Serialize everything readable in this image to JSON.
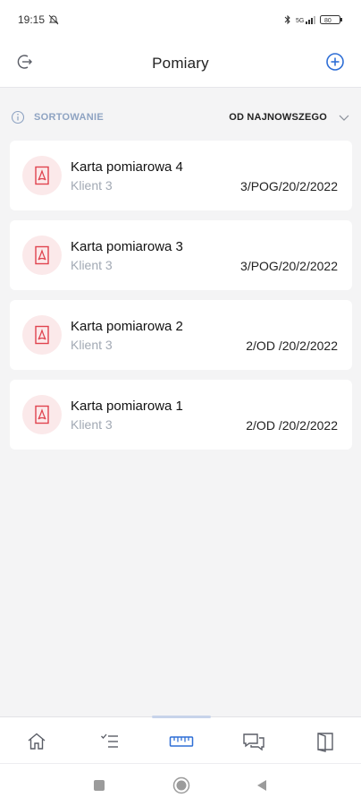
{
  "status_bar": {
    "time": "19:15",
    "icons": [
      "bell-off-icon",
      "bluetooth-icon",
      "signal-icon",
      "battery-icon"
    ],
    "battery": "80"
  },
  "header": {
    "title": "Pomiary",
    "left_icon": "logout-icon",
    "right_icon": "add-circle-icon"
  },
  "sort": {
    "label": "SORTOWANIE",
    "value": "OD NAJNOWSZEGO"
  },
  "cards": [
    {
      "name": "Karta pomiarowa 4",
      "client": "Klient 3",
      "code": "3/POG/20/2/2022",
      "icon": "pdf-icon"
    },
    {
      "name": "Karta pomiarowa 3",
      "client": "Klient 3",
      "code": "3/POG/20/2/2022",
      "icon": "pdf-icon"
    },
    {
      "name": "Karta pomiarowa 2",
      "client": "Klient 3",
      "code": "2/OD /20/2/2022",
      "icon": "pdf-icon"
    },
    {
      "name": "Karta pomiarowa 1",
      "client": "Klient 3",
      "code": "2/OD /20/2/2022",
      "icon": "pdf-icon"
    }
  ],
  "bottom_nav": {
    "items": [
      "home-icon",
      "checklist-icon",
      "ruler-icon",
      "chat-icon",
      "door-icon"
    ],
    "active": "ruler-icon"
  },
  "colors": {
    "accent": "#2f6fd6",
    "pdf_red": "#e0434f",
    "pdf_bg": "#fbe9ea",
    "muted": "#a2a9b4"
  }
}
